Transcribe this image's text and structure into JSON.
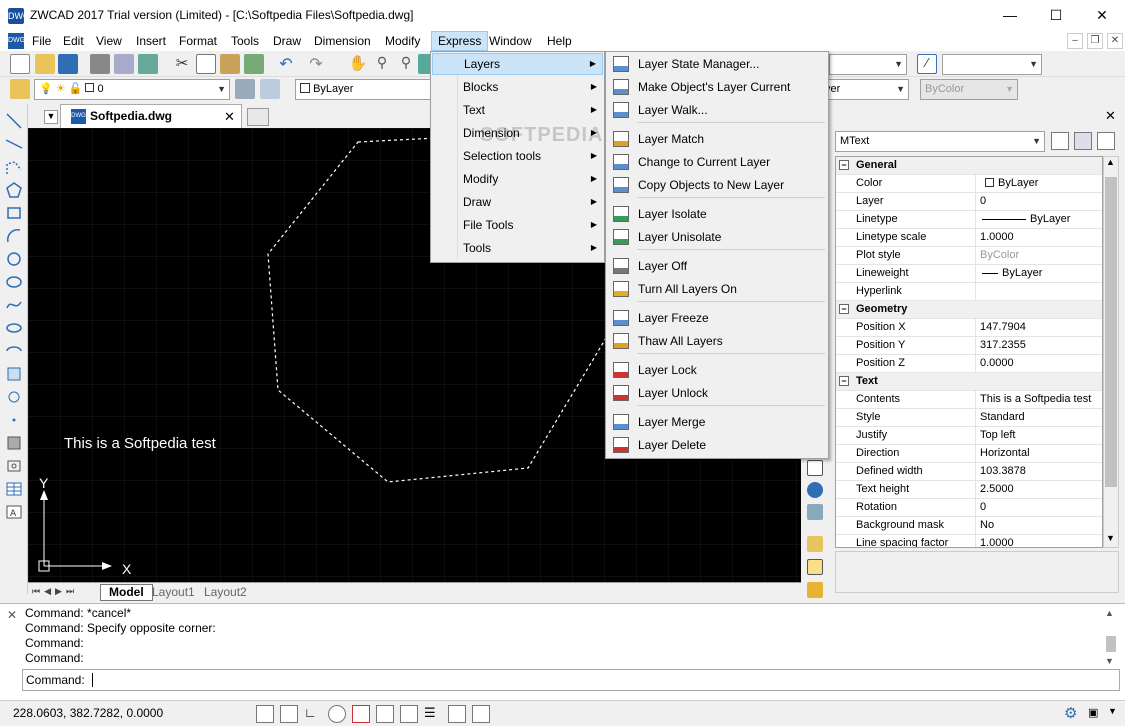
{
  "window": {
    "title": "ZWCAD 2017 Trial version (Limited) - [C:\\Softpedia Files\\Softpedia.dwg]",
    "minimize": "—",
    "maximize": "☐",
    "close": "✕",
    "app_icon": "DWG"
  },
  "menubar": {
    "items": [
      "File",
      "Edit",
      "View",
      "Insert",
      "Format",
      "Tools",
      "Draw",
      "Dimension",
      "Modify",
      "Express",
      "Window",
      "Help"
    ],
    "active": "Express"
  },
  "toolbar2": {
    "layer_value": "0",
    "color_value": "ByLayer",
    "linetype_value": "yer",
    "plotstyle_value": "ByColor"
  },
  "document": {
    "tab_label": "Softpedia.dwg"
  },
  "canvas": {
    "text": "This is a Softpedia test",
    "axis_x": "X",
    "axis_y": "Y",
    "watermark": "SOFTPEDIA"
  },
  "layout_tabs": [
    "Model",
    "Layout1",
    "Layout2"
  ],
  "express_menu": {
    "items": [
      {
        "label": "Layers",
        "icon": "layers-icon"
      },
      {
        "label": "Blocks",
        "icon": "blocks-icon"
      },
      {
        "label": "Text",
        "icon": "text-icon"
      },
      {
        "label": "Dimension",
        "icon": "dimension-icon"
      },
      {
        "label": "Selection tools",
        "icon": "selection-icon"
      },
      {
        "label": "Modify",
        "icon": "modify-icon"
      },
      {
        "label": "Draw",
        "icon": "draw-icon"
      },
      {
        "label": "File Tools",
        "icon": "file-tools-icon"
      },
      {
        "label": "Tools",
        "icon": "tools-icon"
      }
    ]
  },
  "layers_submenu": {
    "items": [
      "Layer State Manager...",
      "Make Object's Layer Current",
      "Layer Walk...",
      "Layer Match",
      "Change to Current Layer",
      "Copy Objects to New Layer",
      "Layer Isolate",
      "Layer Unisolate",
      "Layer Off",
      "Turn All Layers On",
      "Layer Freeze",
      "Thaw All Layers",
      "Layer Lock",
      "Layer Unlock",
      "Layer Merge",
      "Layer Delete"
    ]
  },
  "properties": {
    "object_type": "MText",
    "categories": [
      {
        "name": "General",
        "rows": [
          {
            "name": "Color",
            "value": "ByLayer"
          },
          {
            "name": "Layer",
            "value": "0"
          },
          {
            "name": "Linetype",
            "value": "ByLayer"
          },
          {
            "name": "Linetype scale",
            "value": "1.0000"
          },
          {
            "name": "Plot style",
            "value": "ByColor"
          },
          {
            "name": "Lineweight",
            "value": "ByLayer"
          },
          {
            "name": "Hyperlink",
            "value": ""
          }
        ]
      },
      {
        "name": "Geometry",
        "rows": [
          {
            "name": "Position X",
            "value": "147.7904"
          },
          {
            "name": "Position Y",
            "value": "317.2355"
          },
          {
            "name": "Position Z",
            "value": "0.0000"
          }
        ]
      },
      {
        "name": "Text",
        "rows": [
          {
            "name": "Contents",
            "value": "This is a Softpedia test"
          },
          {
            "name": "Style",
            "value": "Standard"
          },
          {
            "name": "Justify",
            "value": "Top left"
          },
          {
            "name": "Direction",
            "value": "Horizontal"
          },
          {
            "name": "Defined width",
            "value": "103.3878"
          },
          {
            "name": "Text height",
            "value": "2.5000"
          },
          {
            "name": "Rotation",
            "value": "0"
          },
          {
            "name": "Background mask",
            "value": "No"
          },
          {
            "name": "Line spacing factor",
            "value": "1.0000"
          }
        ]
      }
    ]
  },
  "command": {
    "history": [
      "Command: *cancel*",
      "Command: Specify opposite corner:",
      "Command:",
      "Command:"
    ],
    "prompt": "Command:"
  },
  "status": {
    "coordinates": "228.0603, 382.7282, 0.0000"
  },
  "colors": {
    "menu_highlight": "#cce4f7",
    "canvas_bg": "#000000",
    "accent": "#1a5aa8"
  }
}
